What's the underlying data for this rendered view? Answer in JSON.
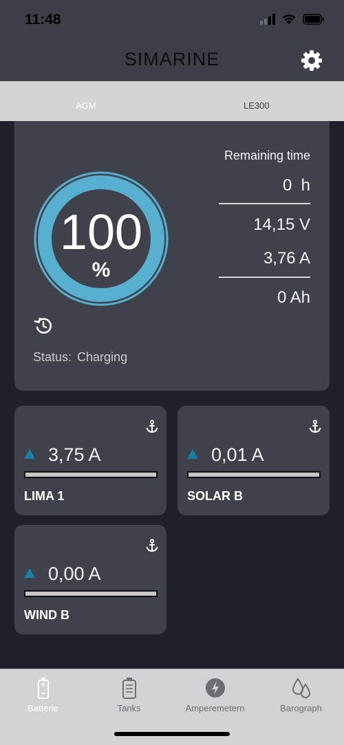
{
  "status_bar": {
    "time": "11:48",
    "icons": [
      "signal-icon",
      "wifi-icon",
      "battery-icon"
    ]
  },
  "header": {
    "title": "SIMARINE",
    "settings_icon": "gear-icon"
  },
  "tabs": [
    {
      "label": "AGM",
      "active": true
    },
    {
      "label": "LE300",
      "active": false
    }
  ],
  "battery": {
    "charge_percent": "100",
    "percent_unit": "%",
    "charge_fraction": 1.0,
    "remaining_label": "Remaining time",
    "remaining_value": "0  h",
    "voltage": "14,15 V",
    "current": "3,76 A",
    "capacity": "0 Ah",
    "history_icon": "history-icon",
    "status_label": "Status:",
    "status_value": "Charging"
  },
  "sources": [
    {
      "name": "LIMA 1",
      "value": "3,75 A",
      "level": 0.0
    },
    {
      "name": "SOLAR B",
      "value": "0,01 A",
      "level": 0.0
    },
    {
      "name": "WIND B",
      "value": "0,00 A",
      "level": 0.0
    }
  ],
  "nav": [
    {
      "label": "Batterie",
      "icon": "battery-nav-icon",
      "active": true
    },
    {
      "label": "Tanks",
      "icon": "tank-icon",
      "active": false
    },
    {
      "label": "Amperemetern",
      "icon": "bolt-icon",
      "active": false
    },
    {
      "label": "Barograph",
      "icon": "droplets-icon",
      "active": false
    }
  ],
  "colors": {
    "accent": "#58b0d0",
    "accent_dark": "#1a7fa6",
    "card": "#3f424b",
    "background": "#1e212a"
  }
}
